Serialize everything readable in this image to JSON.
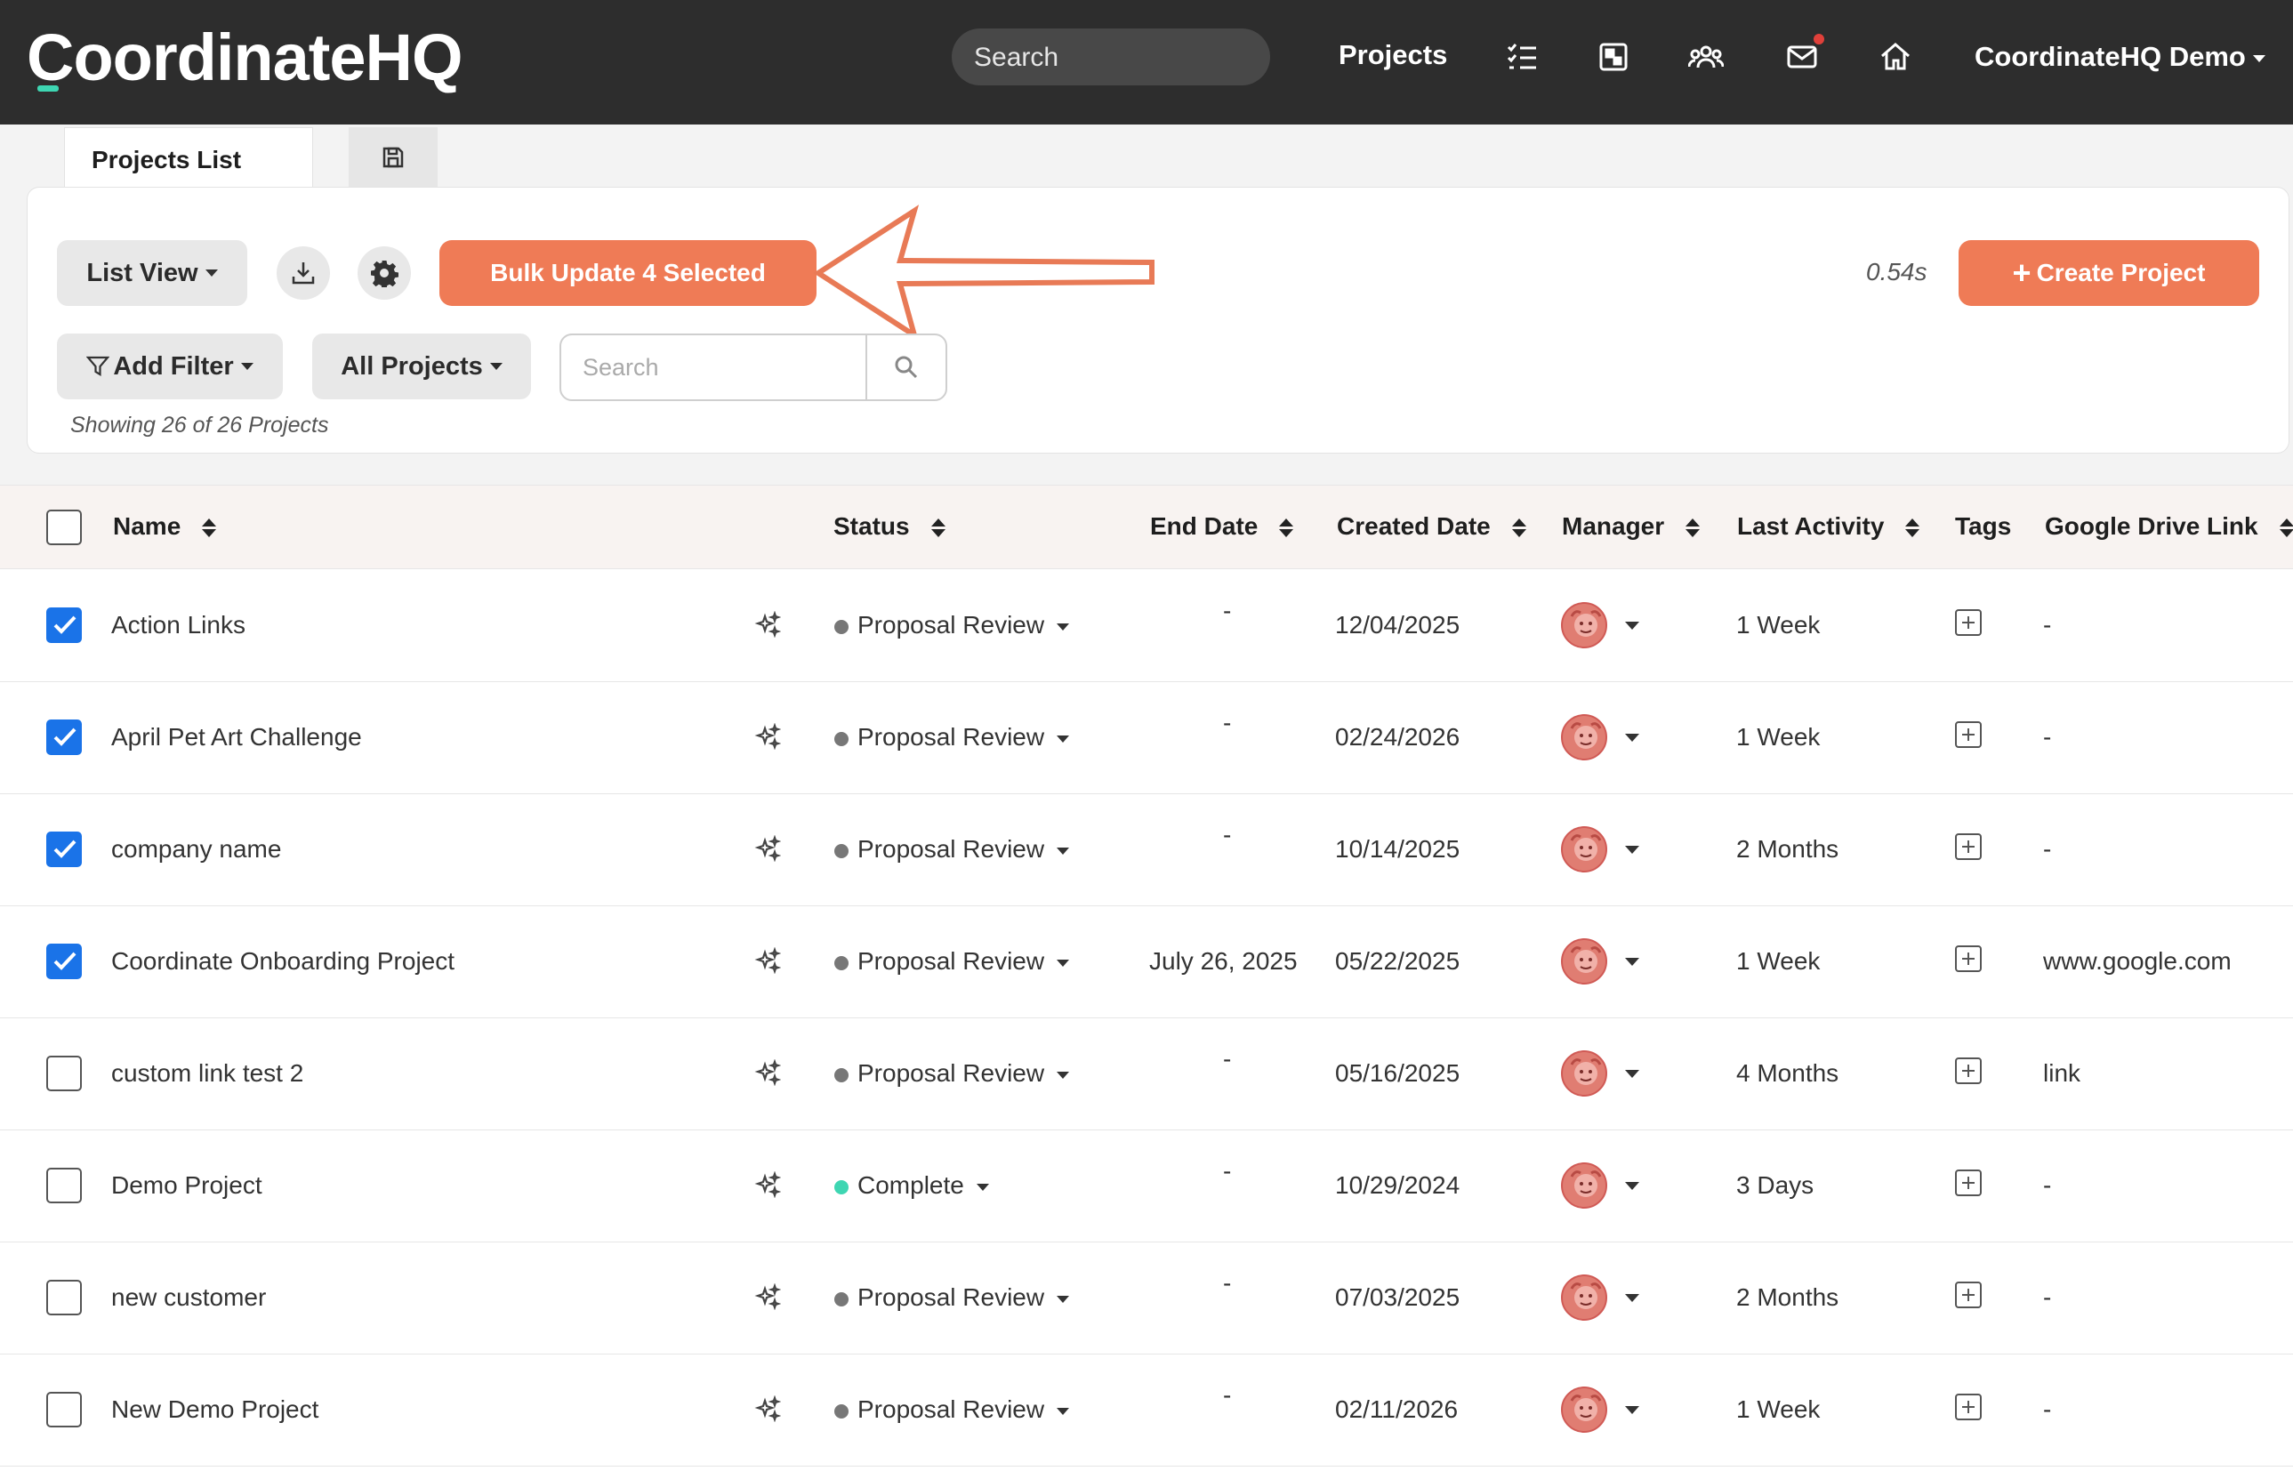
{
  "navbar": {
    "logo": "CoordinateHQ",
    "search_label": "Search",
    "projects_link": "Projects",
    "user_menu": "CoordinateHQ Demo",
    "icons": [
      "tasks-icon",
      "dashboard-icon",
      "team-icon",
      "inbox-icon",
      "home-icon"
    ]
  },
  "tabs": {
    "projects_list": "Projects List",
    "saved_views_icon": "save-icon"
  },
  "toolbar": {
    "list_view": "List View",
    "bulk_update": "Bulk Update 4 Selected",
    "timing": "0.54s",
    "create_project": "Create Project",
    "add_filter": "Add Filter",
    "all_projects": "All Projects",
    "search_placeholder": "Search",
    "showing": "Showing 26 of 26 Projects"
  },
  "table": {
    "headers": {
      "name": "Name",
      "status": "Status",
      "end_date": "End Date",
      "created_date": "Created Date",
      "manager": "Manager",
      "last_activity": "Last Activity",
      "tags": "Tags",
      "google_drive_link": "Google Drive Link"
    },
    "rows": [
      {
        "checked": true,
        "name": "Action Links",
        "status": "Proposal Review",
        "end_date": "-",
        "created": "12/04/2025",
        "last_activity": "1 Week",
        "drive": "-"
      },
      {
        "checked": true,
        "name": "April Pet Art Challenge",
        "status": "Proposal Review",
        "end_date": "-",
        "created": "02/24/2026",
        "last_activity": "1 Week",
        "drive": "-"
      },
      {
        "checked": true,
        "name": "company name",
        "status": "Proposal Review",
        "end_date": "-",
        "created": "10/14/2025",
        "last_activity": "2 Months",
        "drive": "-"
      },
      {
        "checked": true,
        "name": "Coordinate Onboarding Project",
        "status": "Proposal Review",
        "end_date": "July 26, 2025",
        "created": "05/22/2025",
        "last_activity": "1 Week",
        "drive": "www.google.com"
      },
      {
        "checked": false,
        "name": "custom link test 2",
        "status": "Proposal Review",
        "end_date": "-",
        "created": "05/16/2025",
        "last_activity": "4 Months",
        "drive": "link"
      },
      {
        "checked": false,
        "name": "Demo Project",
        "status": "Complete",
        "end_date": "-",
        "created": "10/29/2024",
        "last_activity": "3 Days",
        "drive": "-"
      },
      {
        "checked": false,
        "name": "new customer",
        "status": "Proposal Review",
        "end_date": "-",
        "created": "07/03/2025",
        "last_activity": "2 Months",
        "drive": "-"
      },
      {
        "checked": false,
        "name": "New Demo Project",
        "status": "Proposal Review",
        "end_date": "-",
        "created": "02/11/2026",
        "last_activity": "1 Week",
        "drive": "-"
      }
    ]
  },
  "colors": {
    "brand_accent": "#3ed6b2",
    "primary_button": "#ef7b56",
    "checkbox_checked": "#1a73e8",
    "status_proposal": "#777777",
    "status_complete": "#3ed6b2",
    "notification": "#e0403a"
  }
}
